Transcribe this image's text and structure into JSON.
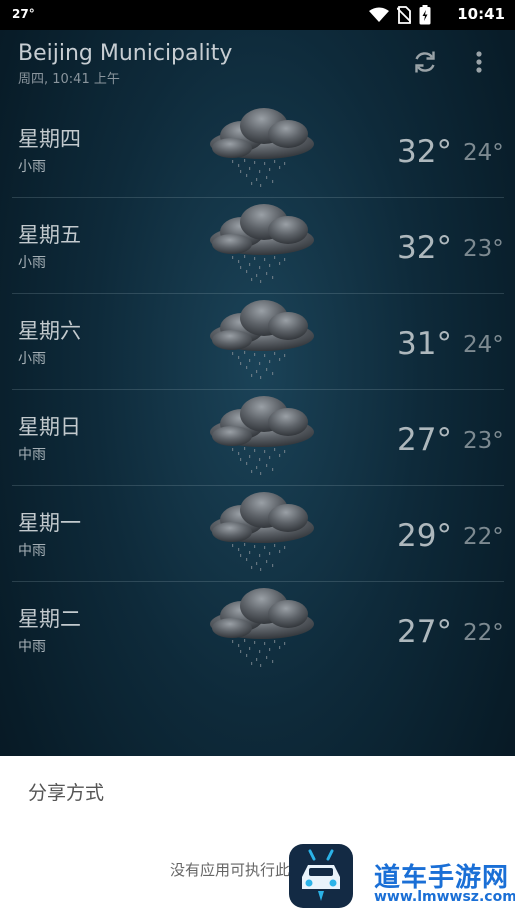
{
  "status_bar": {
    "temperature": "27°",
    "time": "10:41",
    "icons": [
      "wifi-icon",
      "no-sim-icon",
      "battery-charging-icon"
    ]
  },
  "header": {
    "city": "Beijing Municipality",
    "updated": "周四, 10:41 上午",
    "actions": [
      "refresh-icon",
      "more-vert-icon"
    ]
  },
  "forecast": [
    {
      "day": "星期四",
      "condition": "小雨",
      "high": "32°",
      "low": "24°",
      "icon": "rain-cloud-icon"
    },
    {
      "day": "星期五",
      "condition": "小雨",
      "high": "32°",
      "low": "23°",
      "icon": "rain-cloud-icon"
    },
    {
      "day": "星期六",
      "condition": "小雨",
      "high": "31°",
      "low": "24°",
      "icon": "rain-cloud-icon"
    },
    {
      "day": "星期日",
      "condition": "中雨",
      "high": "27°",
      "low": "23°",
      "icon": "rain-cloud-icon"
    },
    {
      "day": "星期一",
      "condition": "中雨",
      "high": "29°",
      "low": "22°",
      "icon": "rain-cloud-icon"
    },
    {
      "day": "星期二",
      "condition": "中雨",
      "high": "27°",
      "low": "22°",
      "icon": "rain-cloud-icon"
    }
  ],
  "share_sheet": {
    "title": "分享方式",
    "message": "没有应用可执行此"
  },
  "watermark": {
    "name": "道车手游网",
    "url": "www.lmwwsz.com"
  },
  "colors": {
    "background": "#0e2a3a",
    "sheet": "#ffffff",
    "watermark": "#1a6fd6"
  }
}
